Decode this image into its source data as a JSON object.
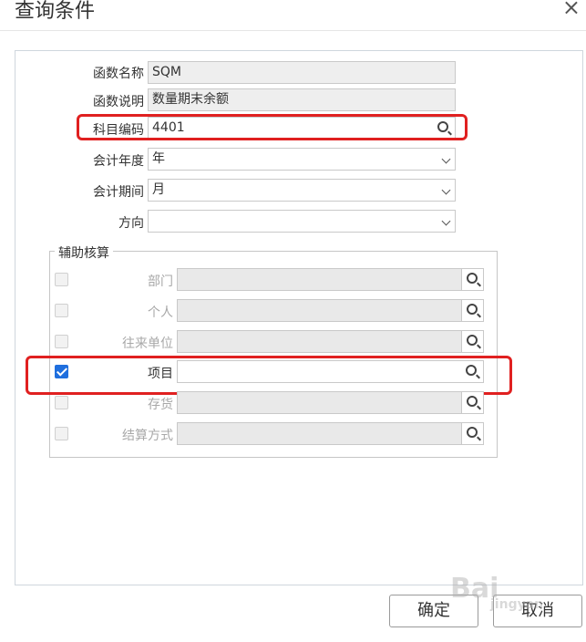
{
  "dialog": {
    "title": "查询条件",
    "close_glyph": "×"
  },
  "form": {
    "function_name": {
      "label": "函数名称",
      "value": "SQM"
    },
    "function_desc": {
      "label": "函数说明",
      "value": "数量期末余额"
    },
    "account_code": {
      "label": "科目编码",
      "value": "4401",
      "icon": "search-icon"
    },
    "fiscal_year": {
      "label": "会计年度",
      "value": "年"
    },
    "fiscal_period": {
      "label": "会计期间",
      "value": "月"
    },
    "direction": {
      "label": "方向",
      "value": ""
    }
  },
  "aux": {
    "legend": "辅助核算",
    "items": [
      {
        "label": "部门",
        "checked": false,
        "enabled": false,
        "value": ""
      },
      {
        "label": "个人",
        "checked": false,
        "enabled": false,
        "value": ""
      },
      {
        "label": "往来单位",
        "checked": false,
        "enabled": false,
        "value": ""
      },
      {
        "label": "项目",
        "checked": true,
        "enabled": true,
        "value": ""
      },
      {
        "label": "存货",
        "checked": false,
        "enabled": false,
        "value": ""
      },
      {
        "label": "结算方式",
        "checked": false,
        "enabled": false,
        "value": ""
      }
    ]
  },
  "buttons": {
    "ok": "确定",
    "cancel": "取消"
  },
  "highlight_color": "#e02020",
  "watermark": {
    "text": "Bai",
    "sub": "jingyan"
  }
}
